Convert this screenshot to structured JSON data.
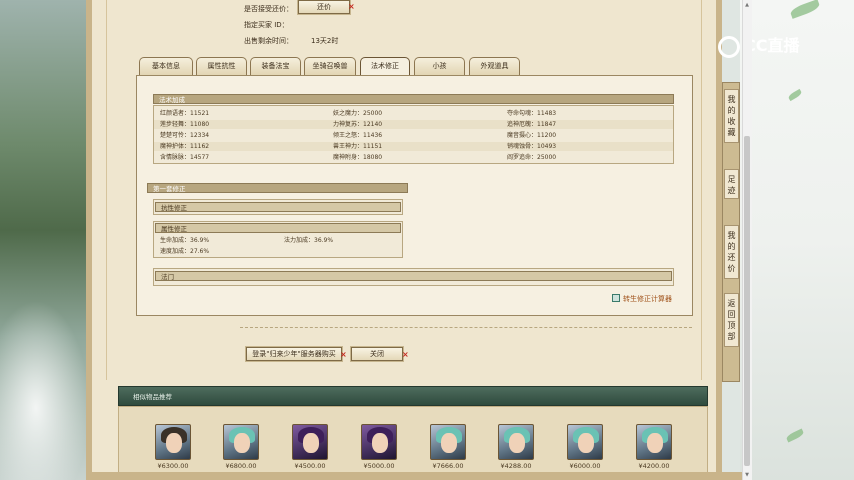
{
  "header": {
    "bargain_label": "是否接受还价：",
    "bargain_button": "还价",
    "buyer_label": "指定买家 ID：",
    "time_label": "出售剩余时间：",
    "time_value": "13天2时"
  },
  "tabs": [
    "基本信息",
    "属性抗性",
    "装备法宝",
    "坐骑召唤兽",
    "法术修正",
    "小孩",
    "外观道具"
  ],
  "spell_section": {
    "title": "法术加成",
    "rows": [
      [
        "红颜语者：11521",
        "妖之魔力：25000",
        "夺命勾魂：11483"
      ],
      [
        "莲步轻舞：11080",
        "力神复苏：12140",
        "追神厄魄：11847"
      ],
      [
        "楚楚可怜：12334",
        "倾王之怒：11436",
        "魔音摄心：11200"
      ],
      [
        "魔神护体：11162",
        "兽王神力：11151",
        "销魂蚀骨：10493"
      ],
      [
        "含情脉脉：14577",
        "魔神附身：18080",
        "阎罗追命：25000"
      ]
    ]
  },
  "correction": {
    "title": "第一套修正",
    "resist_title": "抗性修正",
    "attr_title": "属性修正",
    "attr_rows": [
      [
        "生命加成：36.9%",
        "法力加成：36.9%"
      ],
      [
        "速度加成：27.6%",
        ""
      ]
    ],
    "magic_title": "法门"
  },
  "calc_link": "转生修正计算器",
  "buttons": {
    "login": "登录\"归来少年\"服务器购买",
    "close": "关闭"
  },
  "recommend": {
    "title": "相似物品推荐",
    "items": [
      {
        "price": "¥6300.00"
      },
      {
        "price": "¥6800.00"
      },
      {
        "price": "¥4500.00"
      },
      {
        "price": "¥5000.00"
      },
      {
        "price": "¥7666.00"
      },
      {
        "price": "¥4288.00"
      },
      {
        "price": "¥6000.00"
      },
      {
        "price": "¥4200.00"
      }
    ]
  },
  "sidebar": {
    "logo_text": "CC直播",
    "items": [
      "我的收藏",
      "足迹",
      "我的还价",
      "返回顶部"
    ]
  },
  "colors": {
    "parchment": "#efe6cf",
    "header_green": "#3f5c4e",
    "accent_red": "#c4251c"
  }
}
